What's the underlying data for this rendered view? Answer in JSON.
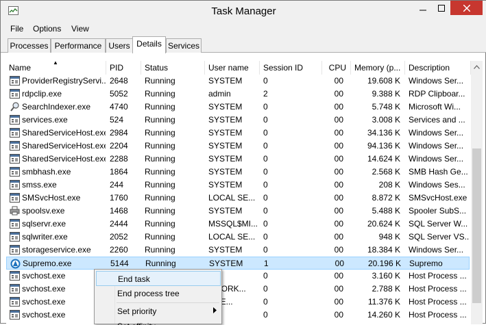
{
  "window": {
    "title": "Task Manager",
    "close_color": "#c7372f",
    "selection_color": "#cce8ff"
  },
  "icons": {
    "app": "task-manager-icon",
    "minimize": "minimize-icon",
    "maximize": "maximize-icon",
    "close": "close-icon",
    "sort": "sort-ascending-icon",
    "scroll_up": "scroll-up-icon",
    "submenu": "chevron-right-icon"
  },
  "menu": {
    "file": "File",
    "options": "Options",
    "view": "View"
  },
  "tabs": [
    {
      "label": "Processes",
      "active": false
    },
    {
      "label": "Performance",
      "active": false
    },
    {
      "label": "Users",
      "active": false
    },
    {
      "label": "Details",
      "active": true
    },
    {
      "label": "Services",
      "active": false
    }
  ],
  "columns": {
    "name": "Name",
    "pid": "PID",
    "status": "Status",
    "user": "User name",
    "session": "Session ID",
    "cpu": "CPU",
    "memory": "Memory (p...",
    "description": "Description"
  },
  "rows": [
    {
      "name": "ProviderRegistryServi...",
      "pid": "2648",
      "status": "Running",
      "user": "SYSTEM",
      "session": "0",
      "cpu": "00",
      "memory": "19.608 K",
      "description": "Windows Ser...",
      "icon": "window-process-icon"
    },
    {
      "name": "rdpclip.exe",
      "pid": "5052",
      "status": "Running",
      "user": "admin",
      "session": "2",
      "cpu": "00",
      "memory": "9.388 K",
      "description": "RDP Clipboar...",
      "icon": "window-process-icon"
    },
    {
      "name": "SearchIndexer.exe",
      "pid": "4740",
      "status": "Running",
      "user": "SYSTEM",
      "session": "0",
      "cpu": "00",
      "memory": "5.748 K",
      "description": "Microsoft Wi...",
      "icon": "search-process-icon"
    },
    {
      "name": "services.exe",
      "pid": "524",
      "status": "Running",
      "user": "SYSTEM",
      "session": "0",
      "cpu": "00",
      "memory": "3.008 K",
      "description": "Services and ...",
      "icon": "window-process-icon"
    },
    {
      "name": "SharedServiceHost.exe",
      "pid": "2984",
      "status": "Running",
      "user": "SYSTEM",
      "session": "0",
      "cpu": "00",
      "memory": "34.136 K",
      "description": "Windows Ser...",
      "icon": "window-process-icon"
    },
    {
      "name": "SharedServiceHost.exe",
      "pid": "2204",
      "status": "Running",
      "user": "SYSTEM",
      "session": "0",
      "cpu": "00",
      "memory": "94.136 K",
      "description": "Windows Ser...",
      "icon": "window-process-icon"
    },
    {
      "name": "SharedServiceHost.exe",
      "pid": "2288",
      "status": "Running",
      "user": "SYSTEM",
      "session": "0",
      "cpu": "00",
      "memory": "14.624 K",
      "description": "Windows Ser...",
      "icon": "window-process-icon"
    },
    {
      "name": "smbhash.exe",
      "pid": "1864",
      "status": "Running",
      "user": "SYSTEM",
      "session": "0",
      "cpu": "00",
      "memory": "2.568 K",
      "description": "SMB Hash Ge...",
      "icon": "window-process-icon"
    },
    {
      "name": "smss.exe",
      "pid": "244",
      "status": "Running",
      "user": "SYSTEM",
      "session": "0",
      "cpu": "00",
      "memory": "208 K",
      "description": "Windows Ses...",
      "icon": "window-process-icon"
    },
    {
      "name": "SMSvcHost.exe",
      "pid": "1760",
      "status": "Running",
      "user": "LOCAL SE...",
      "session": "0",
      "cpu": "00",
      "memory": "8.872 K",
      "description": "SMSvcHost.exe",
      "icon": "window-process-icon"
    },
    {
      "name": "spoolsv.exe",
      "pid": "1468",
      "status": "Running",
      "user": "SYSTEM",
      "session": "0",
      "cpu": "00",
      "memory": "5.488 K",
      "description": "Spooler SubS...",
      "icon": "printer-process-icon"
    },
    {
      "name": "sqlservr.exe",
      "pid": "2444",
      "status": "Running",
      "user": "MSSQL$MI...",
      "session": "0",
      "cpu": "00",
      "memory": "20.624 K",
      "description": "SQL Server W...",
      "icon": "window-process-icon"
    },
    {
      "name": "sqlwriter.exe",
      "pid": "2052",
      "status": "Running",
      "user": "LOCAL SE...",
      "session": "0",
      "cpu": "00",
      "memory": "948 K",
      "description": "SQL Server VS...",
      "icon": "window-process-icon"
    },
    {
      "name": "storageservice.exe",
      "pid": "2260",
      "status": "Running",
      "user": "SYSTEM",
      "session": "0",
      "cpu": "00",
      "memory": "18.384 K",
      "description": "Windows Ser...",
      "icon": "window-process-icon"
    },
    {
      "name": "Supremo.exe",
      "pid": "5144",
      "status": "Running",
      "user": "SYSTEM",
      "session": "1",
      "cpu": "00",
      "memory": "20.196 K",
      "description": "Supremo",
      "icon": "supremo-app-icon",
      "selected": true
    },
    {
      "name": "svchost.exe",
      "pid": "",
      "status": "",
      "user": "",
      "session": "0",
      "cpu": "00",
      "memory": "3.160 K",
      "description": "Host Process ...",
      "icon": "window-process-icon"
    },
    {
      "name": "svchost.exe",
      "pid": "",
      "status": "",
      "user": "TWORK...",
      "session": "0",
      "cpu": "00",
      "memory": "2.788 K",
      "description": "Host Process ...",
      "icon": "window-process-icon"
    },
    {
      "name": "svchost.exe",
      "pid": "",
      "status": "",
      "user": "L SE...",
      "session": "0",
      "cpu": "00",
      "memory": "11.376 K",
      "description": "Host Process ...",
      "icon": "window-process-icon"
    },
    {
      "name": "svchost.exe",
      "pid": "",
      "status": "",
      "user": "",
      "session": "0",
      "cpu": "00",
      "memory": "14.260 K",
      "description": "Host Process ...",
      "icon": "window-process-icon"
    }
  ],
  "context_menu": {
    "end_task": "End task",
    "end_process_tree": "End process tree",
    "set_priority": "Set priority",
    "set_affinity": "Set affinity"
  }
}
